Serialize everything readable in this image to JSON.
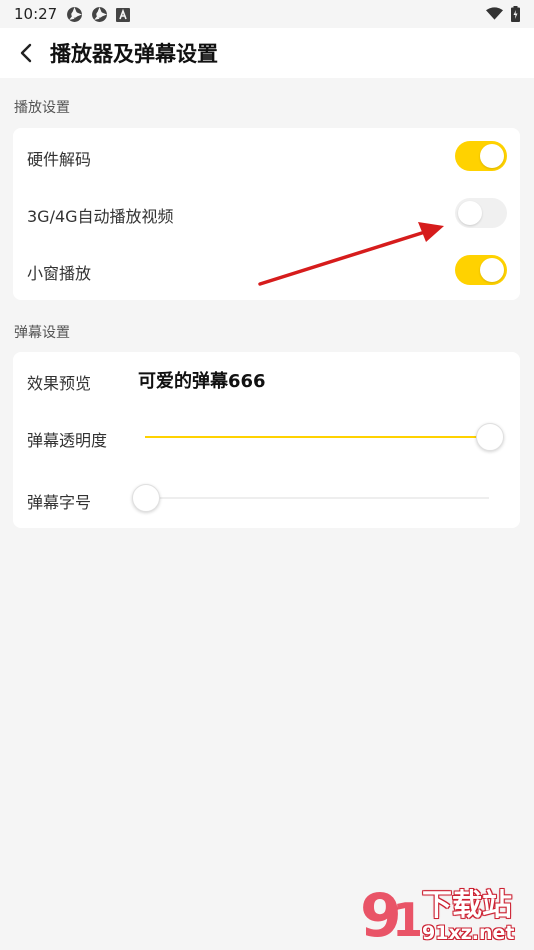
{
  "status_bar": {
    "time": "10:27"
  },
  "header": {
    "title": "播放器及弹幕设置"
  },
  "playback_section": {
    "label": "播放设置",
    "items": [
      {
        "label": "硬件解码",
        "enabled": true
      },
      {
        "label": "3G/4G自动播放视频",
        "enabled": false
      },
      {
        "label": "小窗播放",
        "enabled": true
      }
    ]
  },
  "danmaku_section": {
    "label": "弹幕设置",
    "preview": {
      "label": "效果预览",
      "text": "可爱的弹幕666"
    },
    "opacity": {
      "label": "弹幕透明度",
      "value": 1.0
    },
    "font_size": {
      "label": "弹幕字号",
      "value": 0.0
    }
  },
  "watermark": {
    "brand": "下载站",
    "domain": "91xz.net"
  },
  "colors": {
    "accent": "#ffd200",
    "arrow": "#d61c1c",
    "background": "#f5f5f5"
  }
}
